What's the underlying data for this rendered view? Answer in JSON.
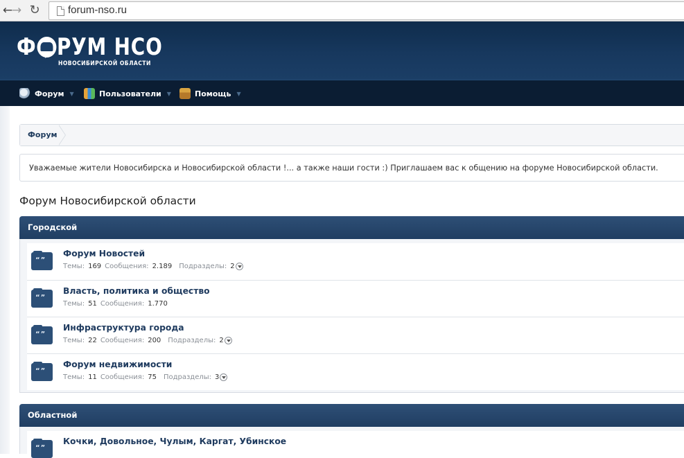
{
  "browser": {
    "url": "forum-nso.ru"
  },
  "site": {
    "logo_left": "Ф",
    "logo_right": "РУМ НСО",
    "logo_subtitle": "НОВОСИБИРСКОЙ ОБЛАСТИ"
  },
  "navbar": {
    "tabs": [
      {
        "label": "Форум",
        "icon": "forum-icon"
      },
      {
        "label": "Пользователи",
        "icon": "users-icon"
      },
      {
        "label": "Помощь",
        "icon": "help-icon"
      }
    ]
  },
  "breadcrumb": {
    "items": [
      "Форум"
    ]
  },
  "notice": {
    "text": "Уважаемые жители Новосибирска и Новосибирской области !... а также наши гости :) Приглашаем вас к общению на форуме Новосибирской области."
  },
  "page": {
    "title": "Форум Новосибирской области"
  },
  "categories": [
    {
      "title": "Городской",
      "nodes": [
        {
          "title": "Форум Новостей",
          "threads_label": "Темы:",
          "threads": "169",
          "messages_label": "Сообщения:",
          "messages": "2.189",
          "subforums_label": "Подразделы:",
          "subforums": "2"
        },
        {
          "title": "Власть, политика и общество",
          "threads_label": "Темы:",
          "threads": "51",
          "messages_label": "Сообщения:",
          "messages": "1.770"
        },
        {
          "title": "Инфраструктура города",
          "threads_label": "Темы:",
          "threads": "22",
          "messages_label": "Сообщения:",
          "messages": "200",
          "subforums_label": "Подразделы:",
          "subforums": "2"
        },
        {
          "title": "Форум недвижимости",
          "threads_label": "Темы:",
          "threads": "11",
          "messages_label": "Сообщения:",
          "messages": "75",
          "subforums_label": "Подразделы:",
          "subforums": "3"
        }
      ]
    },
    {
      "title": "Областной",
      "nodes": [
        {
          "title": "Кочки, Довольное, Чулым, Каргат, Убинское"
        }
      ]
    }
  ],
  "colors": {
    "header_bg": "#17385e",
    "navbar_bg": "#0b1d33",
    "category_bg": "#2e4f76",
    "link": "#1e3a5e"
  }
}
